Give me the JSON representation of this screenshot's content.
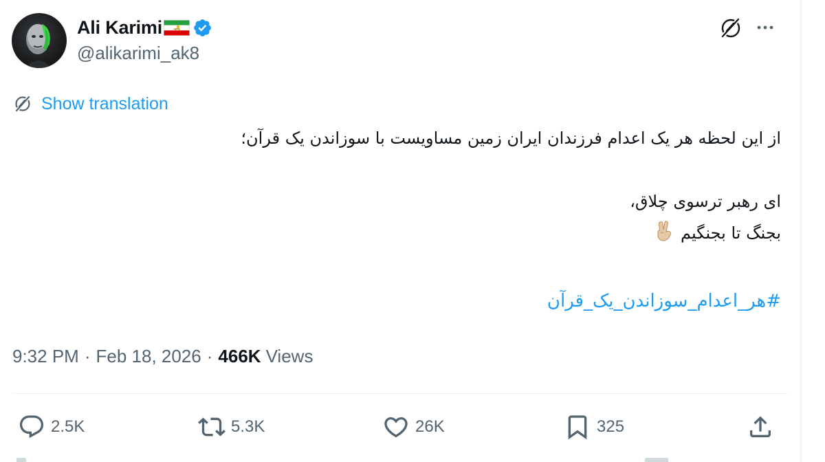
{
  "author": {
    "display_name": "Ali Karimi",
    "handle": "@alikarimi_ak8",
    "verified": true,
    "flag_icon": "iran-lion-and-sun-flag-icon",
    "verified_icon": "verified-badge-icon",
    "avatar_icon": "profile-photo"
  },
  "header_actions": {
    "grok_icon": "grok-icon",
    "more_icon": "more-options-icon"
  },
  "translation": {
    "label": "Show translation",
    "icon": "translate-icon"
  },
  "tweet": {
    "line1": "از این لحظه هر یک اعدام فرزندان ایران زمین مساویست با سوزاندن یک قرآن؛",
    "line2": " ای رهبر ترسوی چلاق،",
    "line3": "بجنگ تا بجنگیم",
    "line3_emoji": "victory-hand-emoji",
    "hashtag": "#هر_اعدام_سوزاندن_یک_قرآن"
  },
  "meta": {
    "time": "9:32 PM",
    "separator": "·",
    "date": "Feb 18, 2026",
    "views_count": "466K",
    "views_label": "Views"
  },
  "actions": {
    "reply": {
      "icon": "reply-icon",
      "count": "2.5K"
    },
    "retweet": {
      "icon": "retweet-icon",
      "count": "5.3K"
    },
    "like": {
      "icon": "heart-icon",
      "count": "26K"
    },
    "bookmark": {
      "icon": "bookmark-icon",
      "count": "325"
    },
    "share": {
      "icon": "share-icon"
    }
  },
  "colors": {
    "text_primary": "#0f1419",
    "text_secondary": "#536471",
    "accent_blue": "#1d9bf0",
    "divider": "#eff3f4"
  }
}
